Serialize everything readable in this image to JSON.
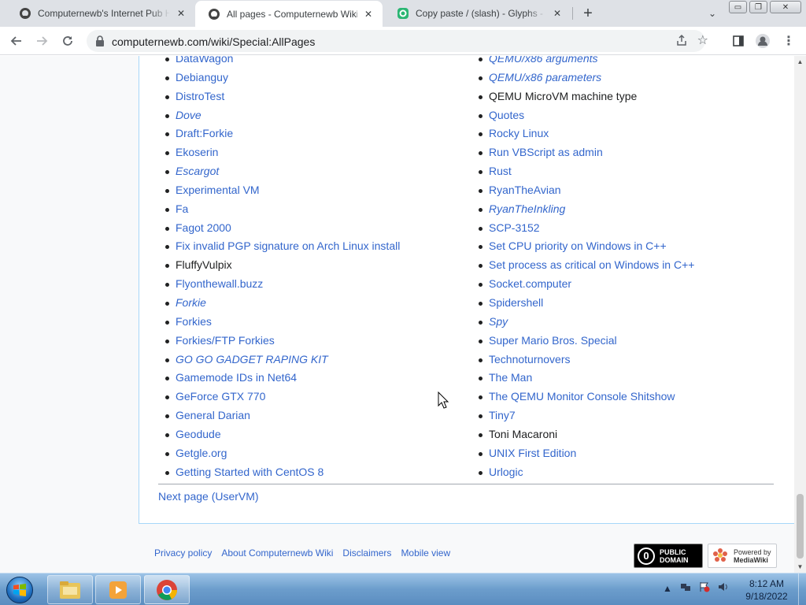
{
  "browser": {
    "tabs": [
      {
        "title": "Computernewb's Internet Pub Hu",
        "active": false
      },
      {
        "title": "All pages - Computernewb Wiki",
        "active": true
      },
      {
        "title": "Copy paste / (slash) - Glyphs - G",
        "active": false
      }
    ],
    "url": "computernewb.com/wiki/Special:AllPages",
    "window_controls": {
      "minimize": "▭",
      "restore": "❐",
      "close": "✕"
    }
  },
  "page": {
    "col1": [
      {
        "label": "DataWagon",
        "style": "link"
      },
      {
        "label": "Debianguy",
        "style": "link"
      },
      {
        "label": "DistroTest",
        "style": "link"
      },
      {
        "label": "Dove",
        "style": "redir"
      },
      {
        "label": "Draft:Forkie",
        "style": "link"
      },
      {
        "label": "Ekoserin",
        "style": "link"
      },
      {
        "label": "Escargot",
        "style": "redir"
      },
      {
        "label": "Experimental VM",
        "style": "link"
      },
      {
        "label": "Fa",
        "style": "link"
      },
      {
        "label": "Fagot 2000",
        "style": "link"
      },
      {
        "label": "Fix invalid PGP signature on Arch Linux install",
        "style": "link"
      },
      {
        "label": "FluffyVulpix",
        "style": "visited"
      },
      {
        "label": "Flyonthewall.buzz",
        "style": "link"
      },
      {
        "label": "Forkie",
        "style": "redir"
      },
      {
        "label": "Forkies",
        "style": "link"
      },
      {
        "label": "Forkies/FTP Forkies",
        "style": "link"
      },
      {
        "label": "GO GO GADGET RAPING KIT",
        "style": "redir"
      },
      {
        "label": "Gamemode IDs in Net64",
        "style": "link"
      },
      {
        "label": "GeForce GTX 770",
        "style": "link"
      },
      {
        "label": "General Darian",
        "style": "link"
      },
      {
        "label": "Geodude",
        "style": "link"
      },
      {
        "label": "Getgle.org",
        "style": "link"
      },
      {
        "label": "Getting Started with CentOS 8",
        "style": "link"
      }
    ],
    "col2": [
      {
        "label": "QEMU/x86 arguments",
        "style": "redir"
      },
      {
        "label": "QEMU/x86 parameters",
        "style": "redir"
      },
      {
        "label": "QEMU MicroVM machine type",
        "style": "visited"
      },
      {
        "label": "Quotes",
        "style": "link"
      },
      {
        "label": "Rocky Linux",
        "style": "link"
      },
      {
        "label": "Run VBScript as admin",
        "style": "link"
      },
      {
        "label": "Rust",
        "style": "link"
      },
      {
        "label": "RyanTheAvian",
        "style": "link"
      },
      {
        "label": "RyanTheInkling",
        "style": "redir"
      },
      {
        "label": "SCP-3152",
        "style": "link"
      },
      {
        "label": "Set CPU priority on Windows in C++",
        "style": "link"
      },
      {
        "label": "Set process as critical on Windows in C++",
        "style": "link"
      },
      {
        "label": "Socket.computer",
        "style": "link"
      },
      {
        "label": "Spidershell",
        "style": "link"
      },
      {
        "label": "Spy",
        "style": "redir"
      },
      {
        "label": "Super Mario Bros. Special",
        "style": "link"
      },
      {
        "label": "Technoturnovers",
        "style": "link"
      },
      {
        "label": "The Man",
        "style": "link"
      },
      {
        "label": "The QEMU Monitor Console Shitshow",
        "style": "link"
      },
      {
        "label": "Tiny7",
        "style": "link"
      },
      {
        "label": "Toni Macaroni",
        "style": "visited"
      },
      {
        "label": "UNIX First Edition",
        "style": "link"
      },
      {
        "label": "Urlogic",
        "style": "link"
      }
    ],
    "next_page": "Next page (UserVM)",
    "footer_links": [
      "Privacy policy",
      "About Computernewb Wiki",
      "Disclaimers",
      "Mobile view"
    ],
    "badge_pd": {
      "line1": "PUBLIC",
      "line2": "DOMAIN",
      "symbol": "0"
    },
    "badge_mw": {
      "line1": "Powered by",
      "line2": "MediaWiki"
    }
  },
  "taskbar": {
    "clock_time": "8:12 AM",
    "clock_date": "9/18/2022"
  },
  "colors": {
    "link": "#3366cc",
    "visited": "#202122",
    "tab_strip": "#dee1e6"
  }
}
